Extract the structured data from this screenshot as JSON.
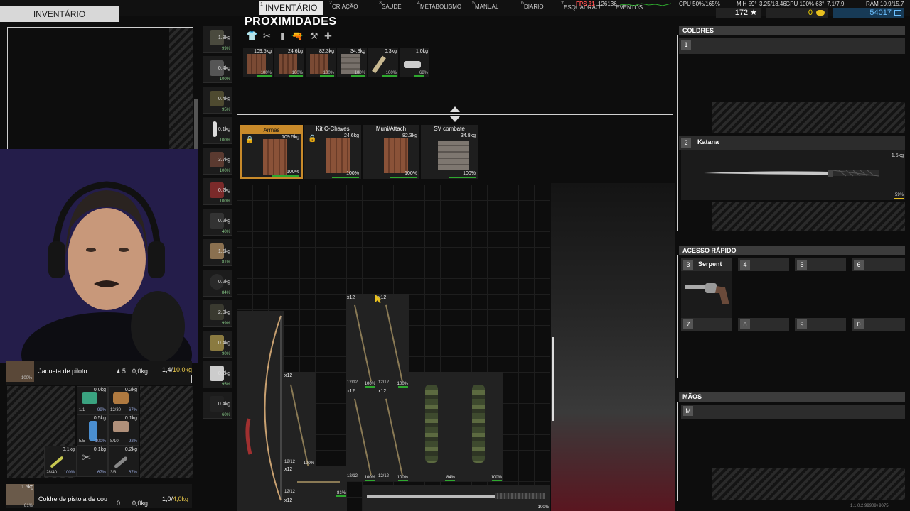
{
  "nav": {
    "tabs": [
      {
        "num": "1",
        "label": "INVENTÁRIO"
      },
      {
        "num": "2",
        "label": "CRIAÇÃO"
      },
      {
        "num": "3",
        "label": "SAUDE"
      },
      {
        "num": "4",
        "label": "METABOLISMO"
      },
      {
        "num": "5",
        "label": "MANUAL"
      },
      {
        "num": "6",
        "label": "DIARIO"
      },
      {
        "num": "7",
        "label": "ESQUADRÃO"
      },
      {
        "num": "",
        "label": "EVENTOS"
      }
    ],
    "fps": "FPS 31",
    "fps_sub": "126136",
    "cpu": "CPU 50%/165%",
    "mem": "MiH 59°",
    "mem2": "3.25/13.46",
    "gpu": "GPU 100% 63°",
    "gpu2": "7.1/7.9",
    "ram": "RAM 10.9/15.7",
    "xp": "172 ★",
    "money": "0",
    "credits": "54017"
  },
  "left": {
    "title": "INVENTÁRIO",
    "jacket": {
      "name": "Jaqueta de piloto",
      "count": "5",
      "weight": "0,0kg",
      "cap_used": "1,4/",
      "cap_max": "10,0kg",
      "pct": "100%"
    },
    "holster": {
      "name": "Coldre de pistola de cou",
      "count": "0",
      "weight": "0,0kg",
      "cap_used": "1,0/",
      "cap_max": "4,0kg",
      "item_weight": "1.5kg",
      "pct": "81%"
    },
    "bag_items": [
      {
        "w": "0.0kg",
        "p": "99%",
        "q": "1/1",
        "color": "#3aa380"
      },
      {
        "w": "0.2kg",
        "p": "67%",
        "q": "12/30",
        "color": "#b07a40"
      },
      {
        "w": "0.5kg",
        "p": "100%",
        "q": "5/5",
        "color": "#4a8ed0"
      },
      {
        "w": "0.1kg",
        "p": "92%",
        "q": "8/10",
        "color": "#b0907a"
      },
      {
        "w": "0.1kg",
        "p": "100%",
        "q": "28/40",
        "color": "#c8c850"
      },
      {
        "w": "0.1kg",
        "p": "67%",
        "q": "",
        "color": "#aaaaaa"
      },
      {
        "w": "0.2kg",
        "p": "67%",
        "q": "3/3",
        "color": "#888888"
      }
    ],
    "equip": [
      {
        "w": "1.8kg",
        "p": "99%"
      },
      {
        "w": "0.4kg",
        "p": "100%"
      },
      {
        "w": "0.4kg",
        "p": "95%"
      },
      {
        "w": "0.1kg",
        "p": "100%"
      },
      {
        "w": "3.7kg",
        "p": "100%"
      },
      {
        "w": "0.2kg",
        "p": "100%"
      },
      {
        "w": "0.2kg",
        "p": "40%"
      },
      {
        "w": "1.5kg",
        "p": "81%"
      },
      {
        "w": "0.2kg",
        "p": "84%"
      },
      {
        "w": "2.0kg",
        "p": "99%"
      },
      {
        "w": "0.4kg",
        "p": "90%"
      },
      {
        "w": "0.2kg",
        "p": "95%"
      },
      {
        "w": "0.4kg",
        "p": "60%"
      }
    ]
  },
  "prox": {
    "title": "PROXIMIDADES",
    "filters": [
      "👕",
      "✂",
      "▮",
      "🔫",
      "⚒",
      "✚"
    ],
    "items": [
      {
        "w": "109.5kg",
        "p": "100%",
        "type": "crate"
      },
      {
        "w": "24.6kg",
        "p": "100%",
        "type": "crate"
      },
      {
        "w": "82.3kg",
        "p": "100%",
        "type": "crate"
      },
      {
        "w": "34.8kg",
        "p": "100%",
        "type": "metal"
      },
      {
        "w": "0.3kg",
        "p": "100%",
        "type": "misc"
      },
      {
        "w": "1.0kg",
        "p": "68%",
        "type": "misc2"
      }
    ],
    "containers": [
      {
        "name": "Armas",
        "w": "109.5kg",
        "p": "100%",
        "locked": true,
        "type": "crate"
      },
      {
        "name": "Kit C-Chaves",
        "w": "24.6kg",
        "p": "100%",
        "locked": true,
        "type": "crate"
      },
      {
        "name": "Muni/Attach",
        "w": "82.3kg",
        "p": "100%",
        "locked": false,
        "type": "crate"
      },
      {
        "name": "SV combate",
        "w": "34.8kg",
        "p": "100%",
        "locked": false,
        "type": "metal"
      }
    ],
    "grid": {
      "arrows": [
        {
          "q": "x12",
          "pp": "12/12",
          "p": "100%"
        },
        {
          "q": "x12",
          "pp": "12/12",
          "p": "100%"
        },
        {
          "q": "x12",
          "pp": "12/12",
          "p": "100%"
        },
        {
          "q": "x12",
          "pp": "12/12",
          "p": "100%"
        },
        {
          "q": "x12",
          "pp": "12/12",
          "p": "100%"
        }
      ],
      "camo": [
        {
          "p": "84%"
        },
        {
          "p": "100%"
        }
      ],
      "arrow_bottom": {
        "q": "x12",
        "pp": "12/12",
        "p": "81%"
      },
      "arrow_bottom2": {
        "q": "x12"
      },
      "katana_p": "100%"
    }
  },
  "right": {
    "holsters": {
      "title": "COLDRES",
      "slot1": "1",
      "slot2": "2",
      "slot2_name": "Katana",
      "slot2_w": "1.5kg",
      "slot2_p": "59%"
    },
    "quick": {
      "title": "ACESSO RÁPIDO",
      "slots": [
        {
          "n": "3",
          "label": "Serpent"
        },
        {
          "n": "4",
          "label": ""
        },
        {
          "n": "5",
          "label": ""
        },
        {
          "n": "6",
          "label": ""
        },
        {
          "n": "7",
          "label": ""
        },
        {
          "n": "8",
          "label": ""
        },
        {
          "n": "9",
          "label": ""
        },
        {
          "n": "0",
          "label": ""
        }
      ]
    },
    "hands": {
      "title": "MÃOS",
      "slot": "M"
    }
  },
  "version": "1.1.0.2.99909+9075"
}
